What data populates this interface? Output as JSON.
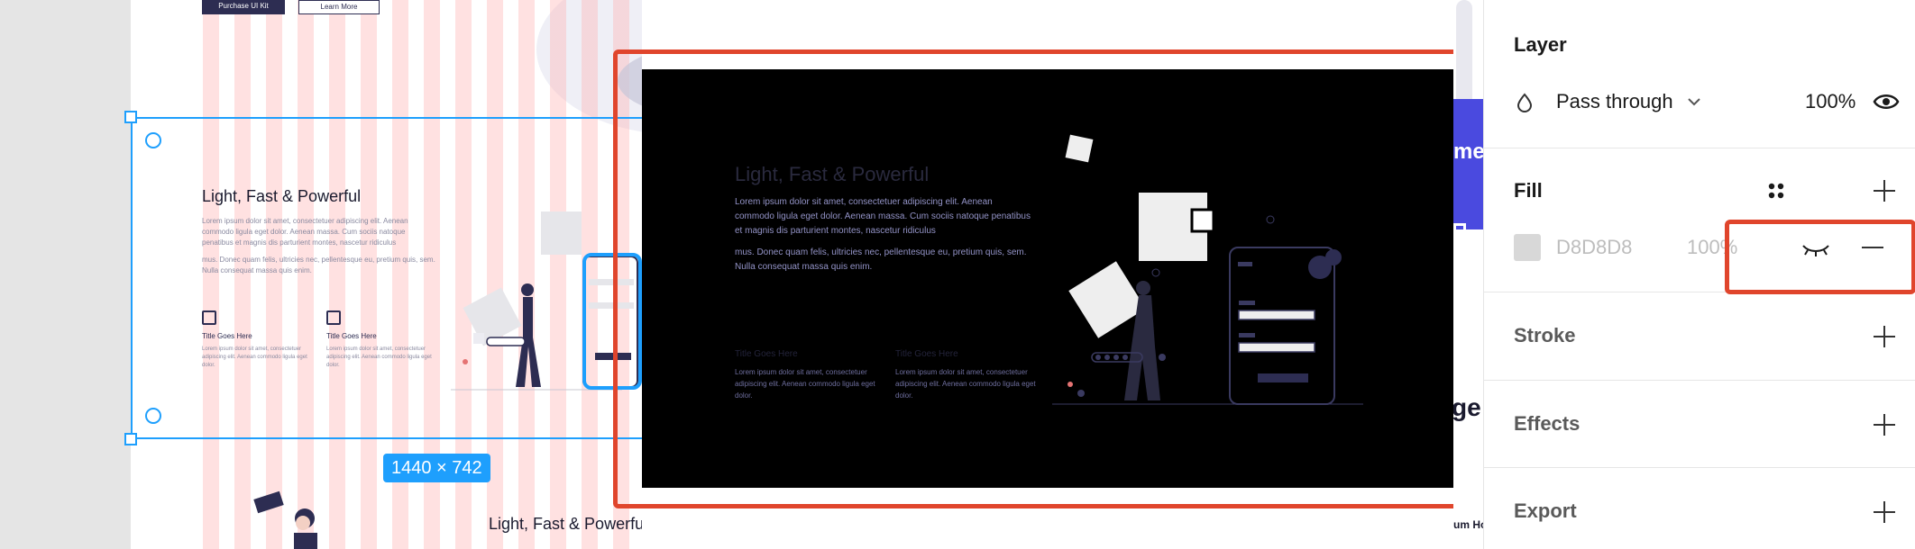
{
  "canvas": {
    "purchase_btn": "Purchase UI Kit",
    "learn_btn": "Learn More",
    "dimensions": "1440 × 742",
    "section_title": "Light, Fast & Powerful",
    "para1": "Lorem ipsum dolor sit amet, consectetuer adipiscing elit. Aenean commodo ligula eget dolor. Aenean massa. Cum sociis natoque penatibus et magnis dis parturient montes, nascetur ridiculus",
    "para2": "mus. Donec quam felis, ultricies nec, pellentesque eu, pretium quis, sem. Nulla consequat massa quis enim.",
    "feature_title": "Title Goes Here",
    "feature_text": "Lorem ipsum dolor sit amet, consectetuer adipiscing elit. Aenean commodo ligula eget dolor.",
    "section_title_2": "Light, Fast & Powerful"
  },
  "preview": {
    "title": "Light, Fast & Powerful",
    "para1": "Lorem ipsum dolor sit amet, consectetuer adipiscing elit. Aenean commodo ligula eget dolor. Aenean massa. Cum sociis natoque penatibus et magnis dis parturient montes, nascetur ridiculus",
    "para2": "mus. Donec quam felis, ultricies nec, pellentesque eu, pretium quis, sem. Nulla consequat massa quis enim.",
    "feature1_title": "Title Goes Here",
    "feature2_title": "Title Goes Here",
    "feature_text": "Lorem ipsum dolor sit amet, consectetuer adipiscing elit. Aenean commodo ligula eget dolor."
  },
  "edge": {
    "fragment1": "me",
    "fragment2": "ge",
    "fragment3": "um Ho"
  },
  "panel": {
    "layer": {
      "title": "Layer",
      "blend_mode": "Pass through",
      "opacity": "100%"
    },
    "fill": {
      "title": "Fill",
      "hex": "D8D8D8",
      "opacity": "100%",
      "swatch_color": "#D8D8D8"
    },
    "stroke_title": "Stroke",
    "effects_title": "Effects",
    "export_title": "Export"
  },
  "colors": {
    "selection": "#1E9FFD",
    "highlight": "#E0452C",
    "accent": "#4A4ADF"
  }
}
